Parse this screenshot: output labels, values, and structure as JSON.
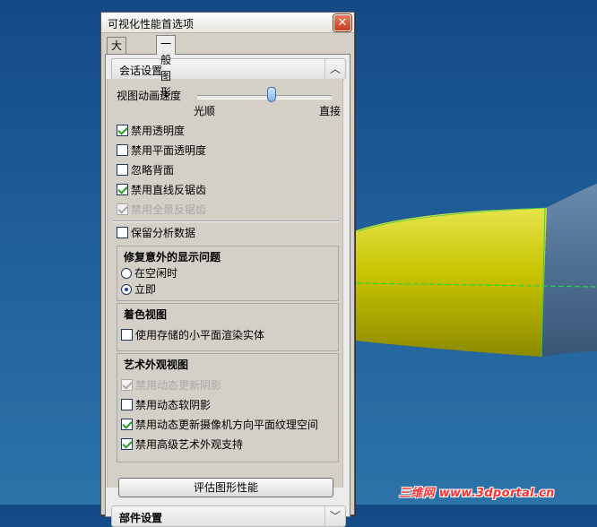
{
  "dialog": {
    "title": "可视化性能首选项",
    "close_glyph": "✕"
  },
  "tabs": [
    {
      "label": "大模型",
      "active": false
    },
    {
      "label": "一般图形",
      "active": true
    }
  ],
  "session": {
    "header": "会话设置",
    "collapse_glyph": "︿",
    "slider": {
      "label": "视图动画速度",
      "min_label": "光顺",
      "max_label": "直接",
      "value_fraction": 0.55
    },
    "checks": [
      {
        "label": "禁用透明度",
        "checked": true,
        "enabled": true
      },
      {
        "label": "禁用平面透明度",
        "checked": false,
        "enabled": true
      },
      {
        "label": "忽略背面",
        "checked": false,
        "enabled": true
      },
      {
        "label": "禁用直线反锯齿",
        "checked": true,
        "enabled": true
      },
      {
        "label": "禁用全景反锯齿",
        "checked": true,
        "enabled": false
      }
    ],
    "keep_analysis": {
      "label": "保留分析数据",
      "checked": false
    }
  },
  "fix_group": {
    "title": "修复意外的显示问题",
    "options": [
      {
        "label": "在空闲时",
        "selected": false
      },
      {
        "label": "立即",
        "selected": true
      }
    ]
  },
  "shaded_group": {
    "title": "着色视图",
    "checks": [
      {
        "label": "使用存储的小平面渲染实体",
        "checked": false,
        "enabled": true
      }
    ]
  },
  "artistic_group": {
    "title": "艺术外观视图",
    "checks": [
      {
        "label": "禁用动态更新阴影",
        "checked": true,
        "enabled": false
      },
      {
        "label": "禁用动态软阴影",
        "checked": false,
        "enabled": true
      },
      {
        "label": "禁用动态更新摄像机方向平面纹理空间",
        "checked": true,
        "enabled": true
      },
      {
        "label": "禁用高级艺术外观支持",
        "checked": true,
        "enabled": true
      }
    ]
  },
  "eval_button": {
    "label": "评估图形性能"
  },
  "parts_section": {
    "header": "部件设置",
    "expand_glyph": "﹀"
  },
  "watermark": {
    "text": "三维网 www.3dportal.cn"
  },
  "colors": {
    "background": "#1f5e98",
    "model_yellow": "#c6c300",
    "model_body": "#4e6f91",
    "edge_green": "#2bd34a",
    "checkmark": "#21a121"
  }
}
